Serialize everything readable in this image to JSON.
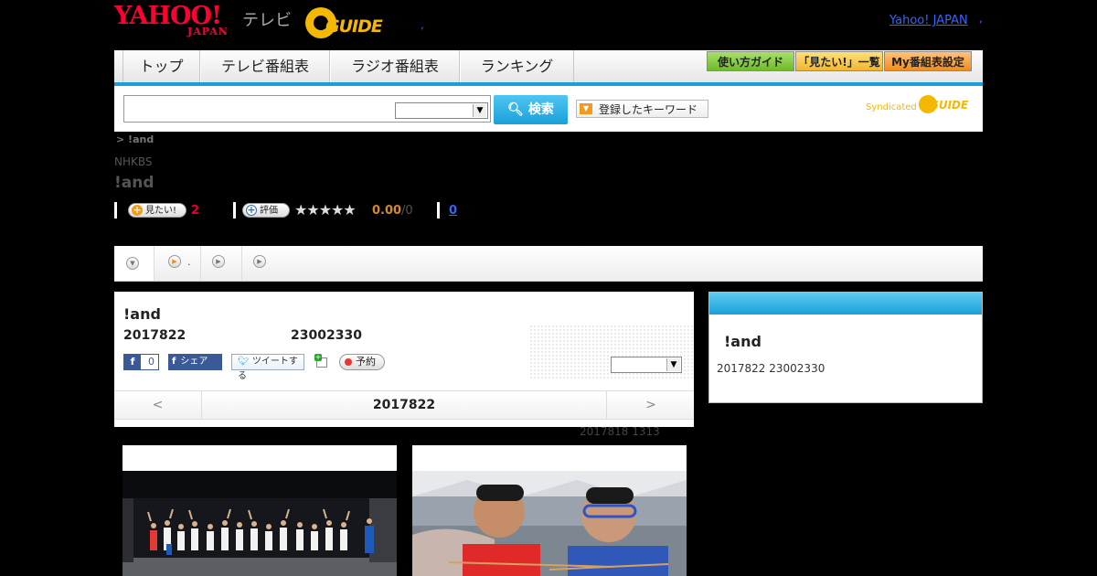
{
  "header": {
    "brand_main": "YAHOO!",
    "brand_sub": "JAPAN",
    "brand_tv": "テレビ",
    "gguide_label": "GUIDE",
    "dot": ",",
    "yahoo_japan_link": "Yahoo! JAPAN",
    "yahoo_japan_dot": ","
  },
  "nav": {
    "tabs": [
      "トップ",
      "テレビ番組表",
      "ラジオ番組表",
      "ランキング"
    ],
    "right_buttons": [
      "使い方ガイド",
      "「見たい!」一覧",
      "My番組表設定"
    ]
  },
  "search": {
    "value": "",
    "button": "検索",
    "keyword_button": "登録したキーワード",
    "syndicated": "Syndicated",
    "syndicated_guide": "GUIDE"
  },
  "breadcrumb": "> !and",
  "channel": "NHKBS",
  "program_title": "!and",
  "stats": {
    "want_label": "見たい!",
    "want_count": "2",
    "rate_label": "評価",
    "stars": "★★★★★",
    "score": "0.00",
    "score_count": "/0",
    "reviews_link": "0"
  },
  "subtabs": [
    "",
    ".",
    "",
    ""
  ],
  "main": {
    "title": "!and",
    "date": "2017822",
    "time": "23002330",
    "fb_count": "0",
    "share_label": "シェア",
    "tweet_label": "ツイートする",
    "reserve_label": "予約",
    "day_prev": "<",
    "day_current": "2017822",
    "day_next": ">",
    "updated": "2017818  1313"
  },
  "side": {
    "title": "!and",
    "datetime": "2017822  23002330"
  },
  "colors": {
    "accent_blue": "#1aa0d8",
    "brand_red": "#ff0033",
    "gguide_yellow": "#f5b800",
    "want_count_red": "#e3003a"
  }
}
